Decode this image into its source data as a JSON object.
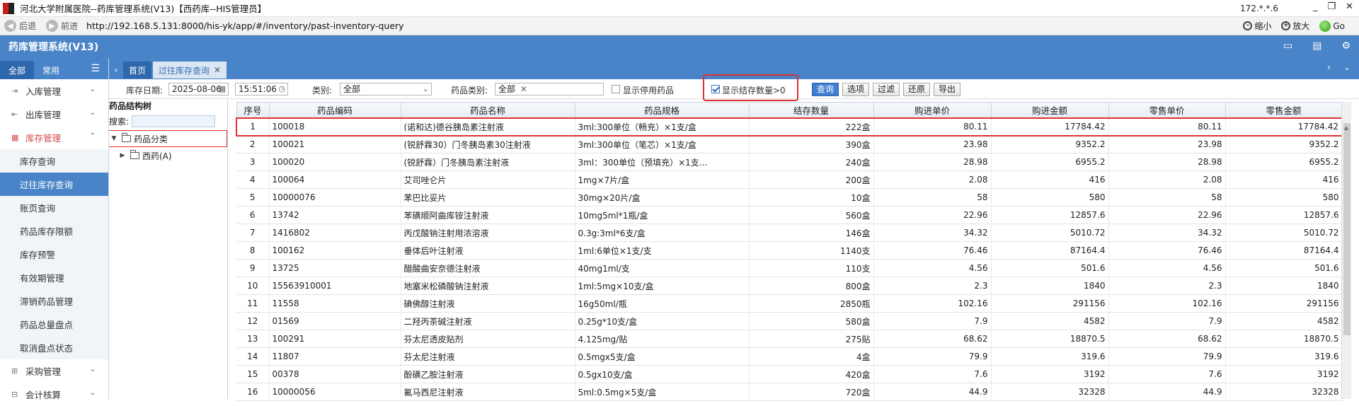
{
  "window": {
    "title": "河北大学附属医院--药库管理系统(V13)【西药库--HIS管理员】",
    "ip": "172.*.*.6",
    "min": "_",
    "max": "❐",
    "close": "✕"
  },
  "browser": {
    "back": "后退",
    "forward": "前进",
    "url": "http://192.168.5.131:8000/his-yk/app/#/inventory/past-inventory-query",
    "zoom_out": "缩小",
    "zoom_in": "放大",
    "go": "Go"
  },
  "app": {
    "title": "药库管理系统(V13)"
  },
  "sidebar": {
    "tabs": [
      "全部",
      "常用"
    ],
    "groups": [
      {
        "label": "入库管理",
        "icon": "inbound-icon"
      },
      {
        "label": "出库管理",
        "icon": "outbound-icon"
      },
      {
        "label": "库存管理",
        "icon": "stock-icon"
      },
      {
        "label": "采购管理",
        "icon": "purchase-icon"
      },
      {
        "label": "会计核算",
        "icon": "accounting-icon"
      }
    ],
    "stock_items": [
      "库存查询",
      "过往库存查询",
      "账页查询",
      "药品库存限额",
      "库存预警",
      "有效期管理",
      "滞销药品管理",
      "药品总量盘点",
      "取消盘点状态"
    ]
  },
  "tabs": {
    "home": "首页",
    "current": "过往库存查询"
  },
  "filters": {
    "date_label": "库存日期:",
    "date": "2025-08-06",
    "time": "15:51:06",
    "category_label": "类别:",
    "category": "全部",
    "drug_type_label": "药品类别:",
    "drug_type": "全部",
    "show_disabled": "显示停用药品",
    "show_positive": "显示结存数量>0"
  },
  "buttons": [
    "查询",
    "选项",
    "过滤",
    "还原",
    "导出"
  ],
  "tree": {
    "title": "药品结构树",
    "search_label": "搜索:",
    "root": "药品分类",
    "child": "西药(A)"
  },
  "table": {
    "headers": [
      "序号",
      "药品编码",
      "药品名称",
      "药品规格",
      "结存数量",
      "购进单价",
      "购进金额",
      "零售单价",
      "零售金额"
    ],
    "rows": [
      [
        "1",
        "100018",
        "(诺和达)德谷胰岛素注射液",
        "3ml:300单位（畅充）×1支/盒",
        "222盒",
        "80.11",
        "17784.42",
        "80.11",
        "17784.42"
      ],
      [
        "2",
        "100021",
        "(锐舒霖30）门冬胰岛素30注射液",
        "3ml:300单位（笔芯）×1支/盒",
        "390盒",
        "23.98",
        "9352.2",
        "23.98",
        "9352.2"
      ],
      [
        "3",
        "100020",
        "(锐舒霖）门冬胰岛素注射液",
        "3ml：300单位（预填充）×1支...",
        "240盒",
        "28.98",
        "6955.2",
        "28.98",
        "6955.2"
      ],
      [
        "4",
        "100064",
        "艾司唑仑片",
        "1mg×7片/盒",
        "200盒",
        "2.08",
        "416",
        "2.08",
        "416"
      ],
      [
        "5",
        "10000076",
        "苯巴比妥片",
        "30mg×20片/盒",
        "10盒",
        "58",
        "580",
        "58",
        "580"
      ],
      [
        "6",
        "13742",
        "苯磺顺阿曲库铵注射液",
        "10mg5ml*1瓶/盒",
        "560盒",
        "22.96",
        "12857.6",
        "22.96",
        "12857.6"
      ],
      [
        "7",
        "1416802",
        "丙戊酸钠注射用浓溶液",
        "0.3g:3ml*6支/盒",
        "146盒",
        "34.32",
        "5010.72",
        "34.32",
        "5010.72"
      ],
      [
        "8",
        "100162",
        "垂体后叶注射液",
        "1ml:6单位×1支/支",
        "1140支",
        "76.46",
        "87164.4",
        "76.46",
        "87164.4"
      ],
      [
        "9",
        "13725",
        "醋酸曲安奈德注射液",
        "40mg1ml/支",
        "110支",
        "4.56",
        "501.6",
        "4.56",
        "501.6"
      ],
      [
        "10",
        "15563910001",
        "地塞米松磷酸钠注射液",
        "1ml:5mg×10支/盒",
        "800盒",
        "2.3",
        "1840",
        "2.3",
        "1840"
      ],
      [
        "11",
        "11558",
        "碘佛醇注射液",
        "16g50ml/瓶",
        "2850瓶",
        "102.16",
        "291156",
        "102.16",
        "291156"
      ],
      [
        "12",
        "01569",
        "二羟丙茶碱注射液",
        "0.25g*10支/盒",
        "580盒",
        "7.9",
        "4582",
        "7.9",
        "4582"
      ],
      [
        "13",
        "100291",
        "芬太尼透皮贴剂",
        "4.125mg/贴",
        "275贴",
        "68.62",
        "18870.5",
        "68.62",
        "18870.5"
      ],
      [
        "14",
        "11807",
        "芬太尼注射液",
        "0.5mgx5支/盒",
        "4盒",
        "79.9",
        "319.6",
        "79.9",
        "319.6"
      ],
      [
        "15",
        "00378",
        "酚磺乙胺注射液",
        "0.5gx10支/盒",
        "420盒",
        "7.6",
        "3192",
        "7.6",
        "3192"
      ],
      [
        "16",
        "10000056",
        "氟马西尼注射液",
        "5ml:0.5mg×5支/盒",
        "720盒",
        "44.9",
        "32328",
        "44.9",
        "32328"
      ]
    ]
  }
}
